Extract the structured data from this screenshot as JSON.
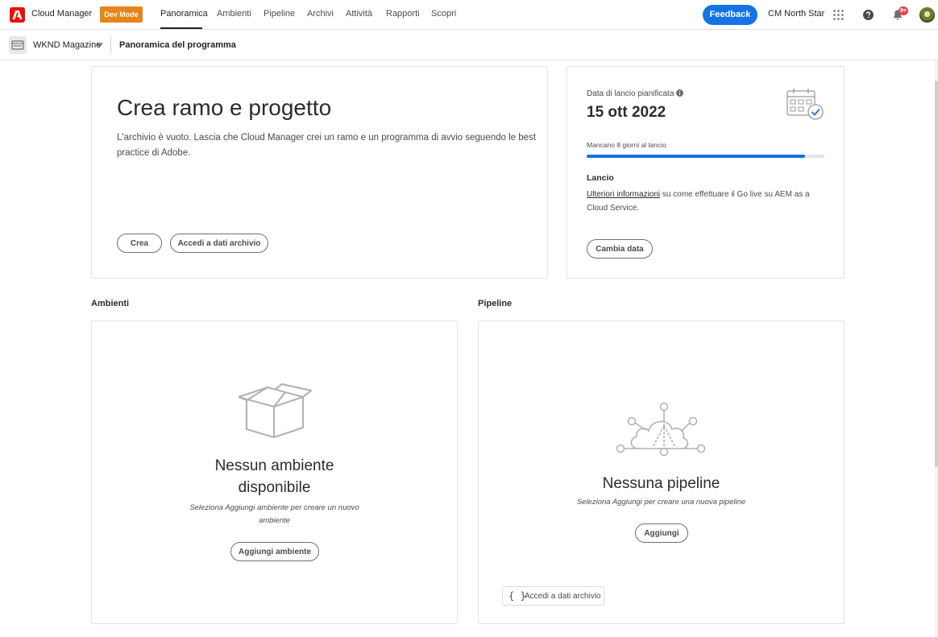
{
  "header": {
    "app_name": "Cloud Manager",
    "dev_mode_label": "Dev Mode",
    "nav": [
      {
        "label": "Panoramica",
        "active": true
      },
      {
        "label": "Ambienti"
      },
      {
        "label": "Pipeline"
      },
      {
        "label": "Archivi"
      },
      {
        "label": "Attività"
      },
      {
        "label": "Rapporti"
      },
      {
        "label": "Scopri"
      }
    ],
    "feedback_label": "Feedback",
    "org_name": "CM North Star",
    "notification_count": "9+",
    "accent_color": "#1473e6",
    "brand_color": "#eb1000",
    "dev_mode_color": "#e68619"
  },
  "subheader": {
    "program_name": "WKND Magazine",
    "page_title": "Panoramica del programma"
  },
  "hero": {
    "title": "Crea ramo e progetto",
    "description": "L'archivio è vuoto. Lascia che Cloud Manager crei un ramo e un programma di avvio seguendo le best practice di Adobe.",
    "create_label": "Crea",
    "access_repo_label": "Accedi a dati archivio"
  },
  "launch": {
    "label": "Data di lancio pianificata",
    "date": "15 ott 2022",
    "countdown": "Mancano 8 giorni al lancio",
    "progress": 0.92,
    "section_title": "Lancio",
    "link_text": "Ulteriori informazioni",
    "info_text": " su come effettuare il Go live su AEM as a Cloud Service.",
    "change_date_label": "Cambia data"
  },
  "environments": {
    "heading": "Ambienti",
    "empty_title": "Nessun ambiente disponibile",
    "empty_desc": "Seleziona Aggiungi ambiente per creare un nuovo ambiente",
    "add_label": "Aggiungi ambiente"
  },
  "pipelines": {
    "heading": "Pipeline",
    "empty_title": "Nessuna pipeline",
    "empty_desc": "Seleziona Aggiungi per creare una nuova pipeline",
    "add_label": "Aggiungi",
    "access_repo_label": "Accedi a dati archivio"
  }
}
